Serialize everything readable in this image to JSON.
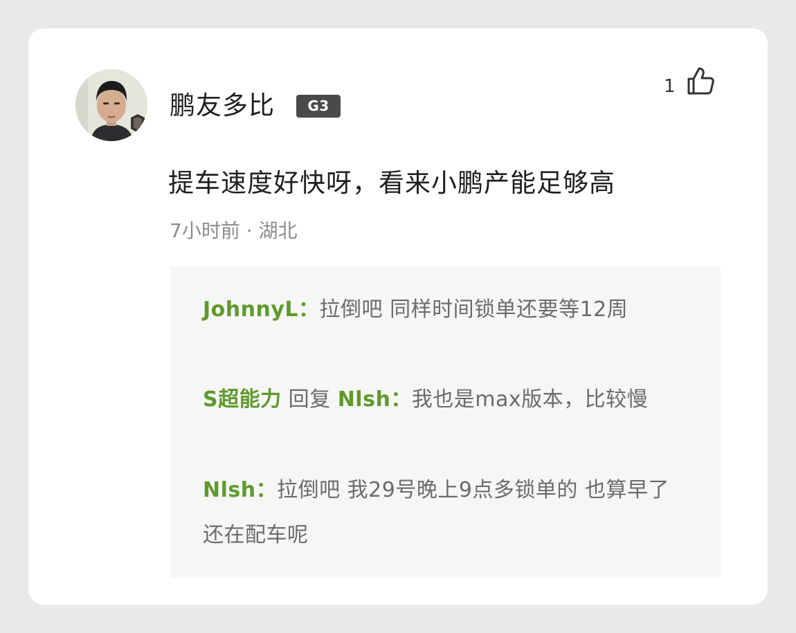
{
  "comment": {
    "username": "鹏友多比",
    "level_badge": "G3",
    "like_count": "1",
    "text": "提车速度好快呀，看来小鹏产能足够高",
    "time": "7小时前",
    "separator": "·",
    "location": "湖北"
  },
  "replies": [
    {
      "author": "JohnnyL",
      "colon": "：",
      "reply_to_word": "",
      "reply_to": "",
      "text": "拉倒吧 同样时间锁单还要等12周"
    },
    {
      "author": "S超能力",
      "colon": "：",
      "reply_to_word": "回复",
      "reply_to": "Nlsh",
      "text": "我也是max版本，比较慢"
    },
    {
      "author": "Nlsh",
      "colon": "：",
      "reply_to_word": "",
      "reply_to": "",
      "text": "拉倒吧 我29号晚上9点多锁单的 也算早了 还在配车呢"
    }
  ],
  "colors": {
    "username_link": "#5f9a2c",
    "reply_text": "#6b6b6b",
    "meta_text": "#8c8c8c",
    "badge_bg": "#4a4a4a",
    "reply_bg": "#f6f6f6"
  },
  "icons": {
    "like": "thumbs-up-icon"
  }
}
